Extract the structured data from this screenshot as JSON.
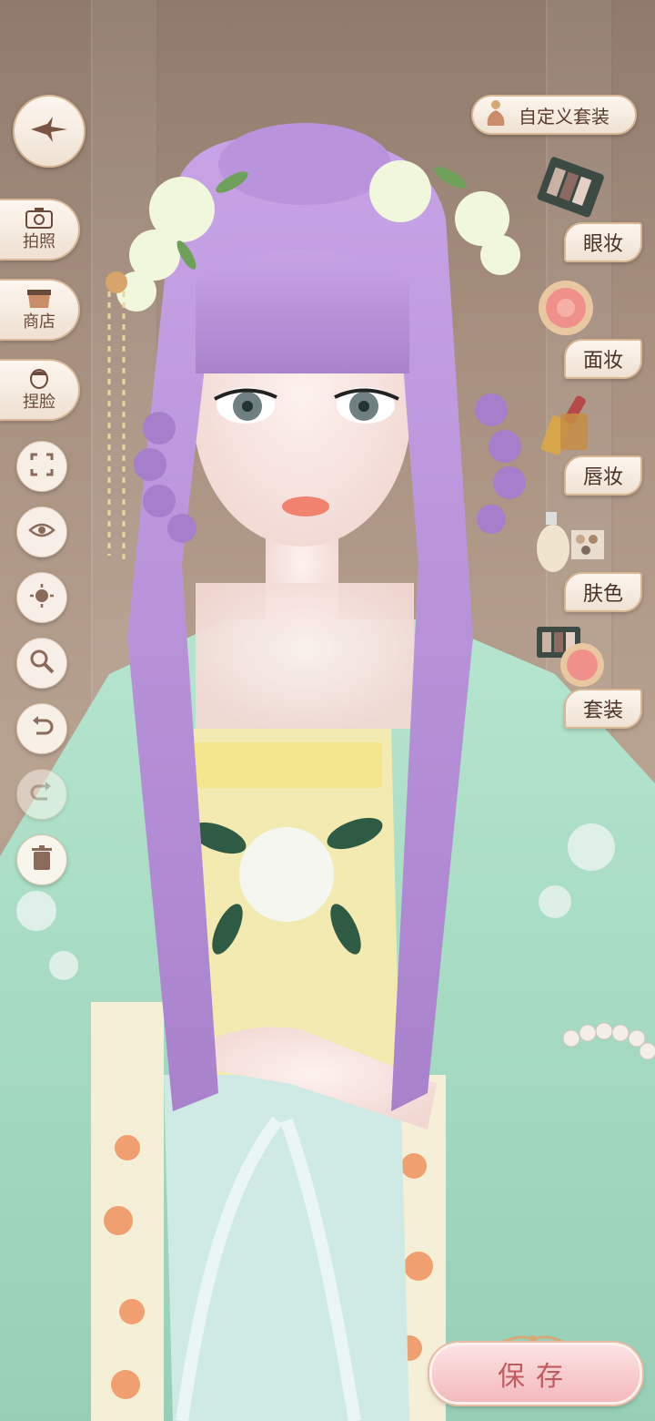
{
  "left_toolbar": {
    "back_icon": "compass-star-icon",
    "photo_label": "拍照",
    "shop_label": "商店",
    "face_label": "捏脸",
    "tools": [
      "focus-frame-icon",
      "eye-icon",
      "sun-light-icon",
      "zoom-icon",
      "undo-icon",
      "redo-icon",
      "trash-icon"
    ]
  },
  "right_panel": {
    "custom_outfit_label": "自定义套装",
    "items": [
      {
        "label": "眼妆",
        "icon": "eyeshadow-palette-icon"
      },
      {
        "label": "面妆",
        "icon": "blush-compact-icon"
      },
      {
        "label": "唇妆",
        "icon": "lipstick-icon"
      },
      {
        "label": "肤色",
        "icon": "foundation-bottle-icon"
      },
      {
        "label": "套装",
        "icon": "makeup-set-icon"
      }
    ]
  },
  "save_label": "保存",
  "colors": {
    "hair": "#b58fd6",
    "robe": "#a9dcc4",
    "inner_dress": "#f2eab0",
    "accent_pink": "#f3b9bd",
    "button_border": "#d6b896"
  }
}
